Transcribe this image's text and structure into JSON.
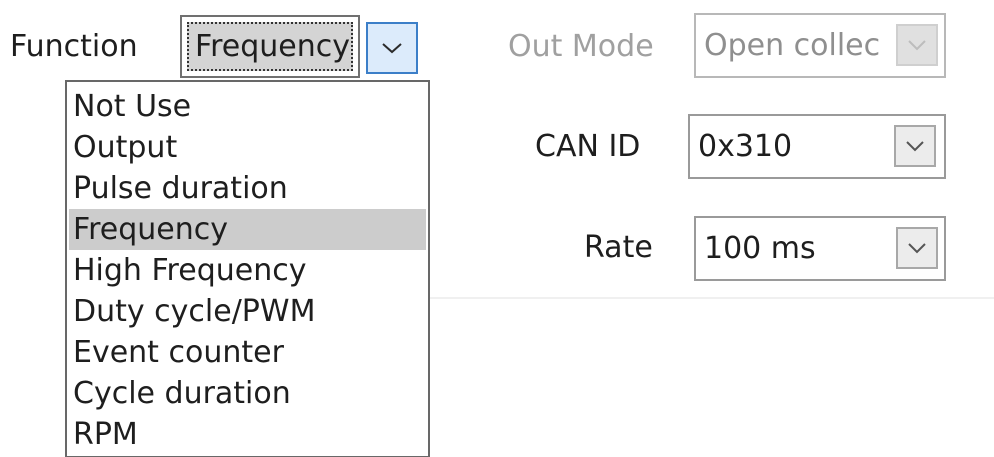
{
  "function": {
    "label": "Function",
    "selected": "Frequency",
    "options": [
      "Not Use",
      "Output",
      "Pulse duration",
      "Frequency",
      "High Frequency",
      "Duty cycle/PWM",
      "Event counter",
      "Cycle duration",
      "RPM"
    ],
    "selected_index": 3
  },
  "out_mode": {
    "label": "Out Mode",
    "value": "Open collec",
    "enabled": false
  },
  "can_id": {
    "label": "CAN ID",
    "value": "0x310"
  },
  "rate": {
    "label": "Rate",
    "value": "100 ms"
  },
  "icons": {
    "dropdown_arrow": "chevron-down-icon"
  },
  "colors": {
    "selected_item_bg": "#cccccc",
    "focus_button_border": "#3c7fc8",
    "focus_button_bg": "#dcebfb",
    "disabled_text": "#a0a0a0"
  }
}
